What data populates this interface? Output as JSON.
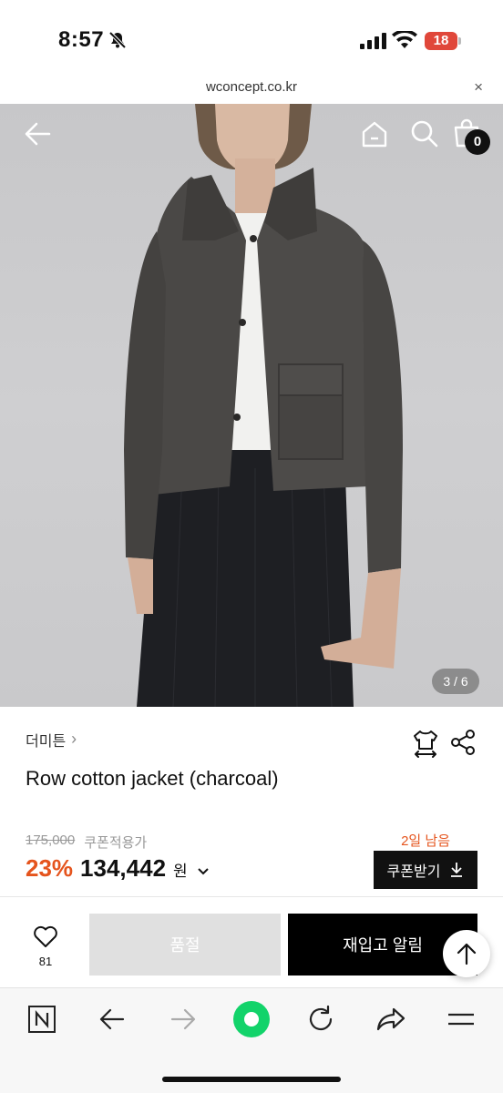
{
  "status_bar": {
    "time": "8:57",
    "battery": "18"
  },
  "url_bar": {
    "url": "wconcept.co.kr",
    "close": "×"
  },
  "header": {
    "cart_count": "0"
  },
  "gallery": {
    "pager": "3 / 6"
  },
  "product": {
    "brand": "더미튼",
    "brand_chevron": "›",
    "title": "Row cotton jacket (charcoal)",
    "original_price": "175,000",
    "coupon_note": "쿠폰적용가",
    "days_left": "2일 남음",
    "discount": "23%",
    "price": "134,442",
    "currency": "원",
    "coupon_button": "쿠폰받기"
  },
  "action_bar": {
    "like_count": "81",
    "soldout_label": "품절",
    "restock_label": "재입고 알림"
  },
  "colors": {
    "accent": "#e5541d",
    "black": "#111111",
    "disabled": "#e0e0e0",
    "browser_green": "#12d36a"
  },
  "icons": [
    "bell-slash-icon",
    "signal-icon",
    "wifi-icon",
    "back-arrow-icon",
    "home-icon",
    "search-icon",
    "bag-icon",
    "fit-size-icon",
    "share-icon",
    "download-icon",
    "heart-icon",
    "arrow-up-icon",
    "naver-icon",
    "browser-back-icon",
    "browser-forward-icon",
    "green-dot-icon",
    "reload-icon",
    "share-forward-icon",
    "menu-icon"
  ]
}
